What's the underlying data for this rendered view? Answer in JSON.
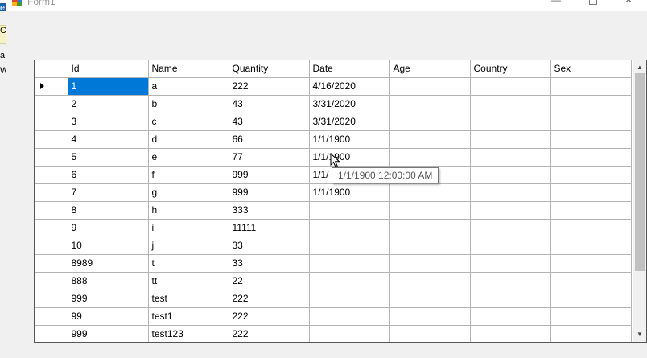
{
  "window": {
    "title": "Form1",
    "minimize_glyph": "—",
    "close_glyph": "✕"
  },
  "background_fragments": {
    "frag1": "e",
    "frag2": "C",
    "frag3": "a",
    "frag4": "W"
  },
  "grid": {
    "columns": [
      "Id",
      "Name",
      "Quantity",
      "Date",
      "Age",
      "Country",
      "Sex"
    ],
    "rows": [
      [
        "1",
        "a",
        "222",
        "4/16/2020",
        "",
        "",
        ""
      ],
      [
        "2",
        "b",
        "43",
        "3/31/2020",
        "",
        "",
        ""
      ],
      [
        "3",
        "c",
        "43",
        "3/31/2020",
        "",
        "",
        ""
      ],
      [
        "4",
        "d",
        "66",
        "1/1/1900",
        "",
        "",
        ""
      ],
      [
        "5",
        "e",
        "77",
        "1/1/1900",
        "",
        "",
        ""
      ],
      [
        "6",
        "f",
        "999",
        "1/1/",
        "",
        "",
        ""
      ],
      [
        "7",
        "g",
        "999",
        "1/1/1900",
        "",
        "",
        ""
      ],
      [
        "8",
        "h",
        "333",
        "",
        "",
        "",
        ""
      ],
      [
        "9",
        "i",
        "11111",
        "",
        "",
        "",
        ""
      ],
      [
        "10",
        "j",
        "33",
        "",
        "",
        "",
        ""
      ],
      [
        "8989",
        "t",
        "33",
        "",
        "",
        "",
        ""
      ],
      [
        "888",
        "tt",
        "22",
        "",
        "",
        "",
        ""
      ],
      [
        "999",
        "test",
        "222",
        "",
        "",
        "",
        ""
      ],
      [
        "99",
        "test1",
        "222",
        "",
        "",
        "",
        ""
      ],
      [
        "999",
        "test123",
        "222",
        "",
        "",
        "",
        ""
      ]
    ],
    "current_row_index": 0,
    "selected_cell": {
      "row": 0,
      "column": 0
    }
  },
  "tooltip": {
    "text": "1/1/1900 12:00:00 AM"
  },
  "scrollbar": {
    "up_glyph": "▲",
    "down_glyph": "▼"
  },
  "colors": {
    "selection": "#0078d7",
    "grid_lines": "#b4b4b4",
    "form_background": "#f0f0f0"
  }
}
